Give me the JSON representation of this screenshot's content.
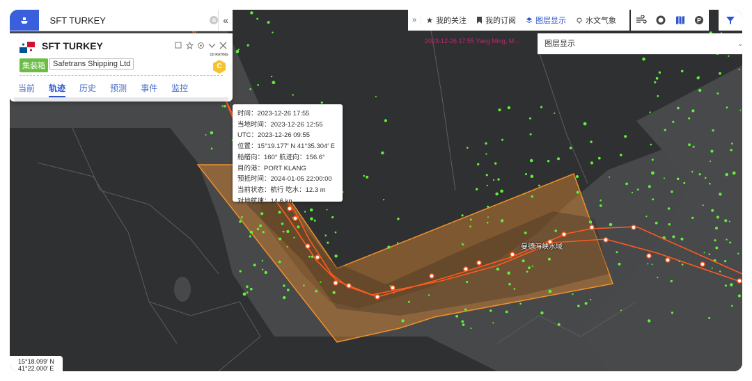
{
  "search": {
    "value": "SFT TURKEY",
    "clear": "⊗",
    "collapse": "«"
  },
  "ship": {
    "name": "SFT TURKEY",
    "type_badge": "集装箱",
    "company": "Safetrans Shipping Ltd",
    "cii_label": "CII RATING",
    "cii_grade": "C",
    "tabs": [
      "当前",
      "轨迹",
      "历史",
      "预测",
      "事件",
      "监控"
    ],
    "active_tab": "轨迹"
  },
  "toolbar": {
    "expand": "»",
    "items": [
      {
        "label": "我的关注",
        "icon": "star-icon"
      },
      {
        "label": "我的订阅",
        "icon": "bookmark-icon"
      },
      {
        "label": "图层显示",
        "icon": "layers-icon",
        "active": true
      },
      {
        "label": "水文气象",
        "icon": "weather-icon"
      }
    ],
    "map_icons": [
      "wind-icon",
      "ring-icon",
      "map-icon",
      "port-icon"
    ],
    "filter_icon": "filter-icon"
  },
  "layer_panel": {
    "title": "图层显示",
    "chevron": "⌄"
  },
  "banner": "2023-12-26 17:55 Yang Ming, M...",
  "popup": {
    "lines": [
      "时间：2023-12-26 17:55",
      "当地时间：2023-12-26 12:55",
      "UTC：2023-12-26 09:55",
      "位置：15°19.177′ N  41°35.304′ E",
      "船艏向：160°  航迹向：156.6°",
      "目的港：PORT KLANG",
      "预抵时间：2024-01-05 22:00:00",
      "当前状态：航行  吃水：12.3 m",
      "对地航速：14.6 kn"
    ]
  },
  "map": {
    "place_label": "曼德海峡水域"
  },
  "coordinates": {
    "lat": "15°18.099′ N",
    "lon": "41°22.000′ E"
  },
  "colors": {
    "accent": "#2f56d1",
    "track": "#ff5a1f",
    "zone": "#e08a2e",
    "vessel_dot": "#5ff03a",
    "land": "#2f3032",
    "sea": "#48494b"
  }
}
